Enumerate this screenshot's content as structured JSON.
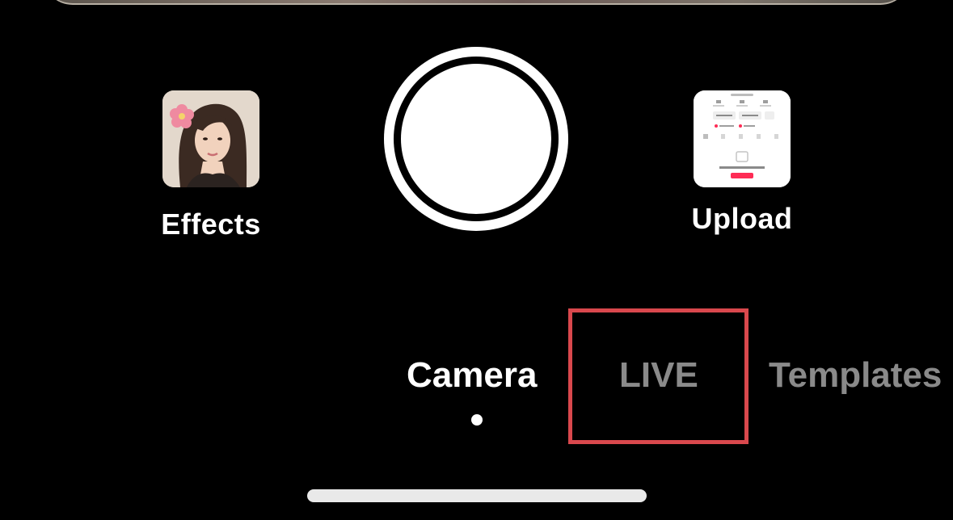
{
  "toolbar": {
    "effects_label": "Effects",
    "upload_label": "Upload"
  },
  "modes": {
    "tabs": [
      {
        "label": "Camera",
        "active": true
      },
      {
        "label": "LIVE",
        "active": false,
        "highlighted": true
      },
      {
        "label": "Templates",
        "active": false
      }
    ]
  },
  "colors": {
    "background": "#000000",
    "active_text": "#ffffff",
    "inactive_text": "#8a8a8a",
    "highlight_border": "#d9484d",
    "upload_button_accent": "#fe2c55"
  },
  "icons": {
    "effects": "effects-thumbnail-portrait",
    "upload": "upload-gallery-thumbnail",
    "shutter": "record-shutter"
  }
}
